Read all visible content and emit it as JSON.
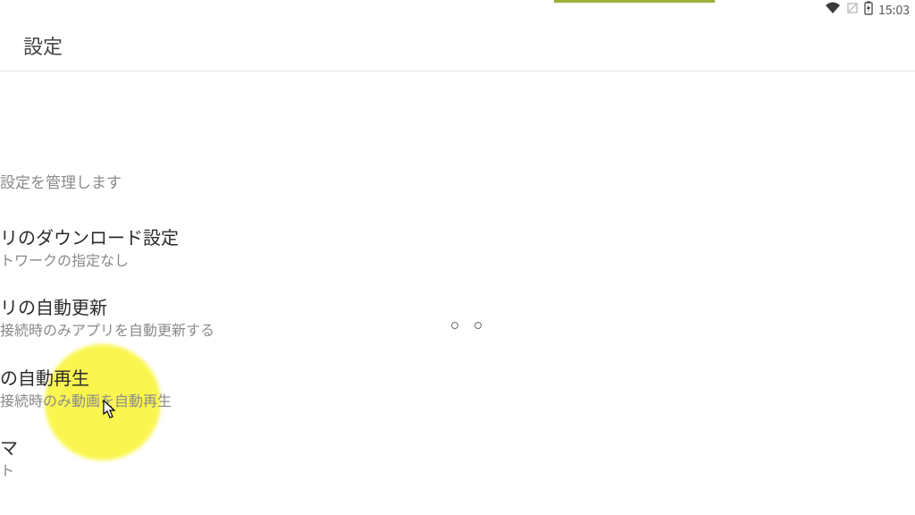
{
  "status_bar": {
    "time": "15:03"
  },
  "app_bar": {
    "title": "設定"
  },
  "settings": {
    "manage_text": "設定を管理します",
    "items": [
      {
        "title": "リのダウンロード設定",
        "desc": "トワークの指定なし"
      },
      {
        "title": "リの自動更新",
        "desc": "接続時のみアプリを自動更新する"
      },
      {
        "title": "の自動再生",
        "desc": "接続時のみ動画を自動再生"
      },
      {
        "title": "マ",
        "desc": "ト"
      }
    ]
  }
}
